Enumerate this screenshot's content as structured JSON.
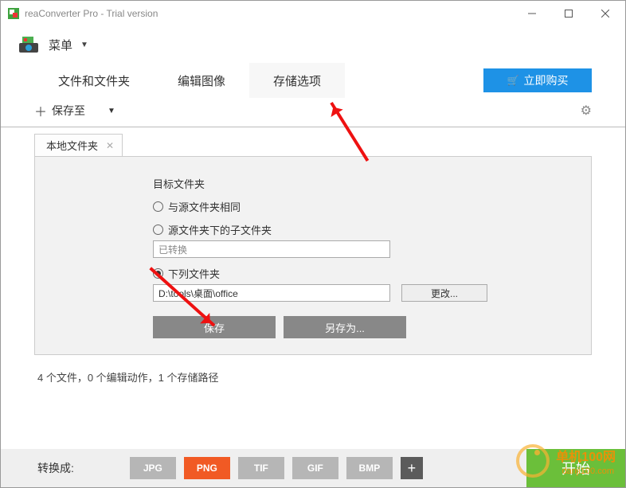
{
  "window": {
    "title": "reaConverter Pro - Trial version"
  },
  "menubar": {
    "menu_label": "菜单"
  },
  "tabs": {
    "files": "文件和文件夹",
    "edit": "编辑图像",
    "save": "存储选项"
  },
  "buy_button": "立即购买",
  "toolbar": {
    "saveto": "保存至"
  },
  "subtab": {
    "label": "本地文件夹"
  },
  "panel": {
    "section_label": "目标文件夹",
    "opt_same": "与源文件夹相同",
    "opt_subfolder": "源文件夹下的子文件夹",
    "subfolder_value": "已转换",
    "opt_following": "下列文件夹",
    "path_value": "D:\\tools\\桌面\\office",
    "change_btn": "更改...",
    "save_btn": "保存",
    "saveas_btn": "另存为..."
  },
  "status": {
    "text": "4 个文件，0 个编辑动作，1 个存储路径"
  },
  "bottombar": {
    "convert_label": "转换成:",
    "formats": {
      "jpg": "JPG",
      "png": "PNG",
      "tif": "TIF",
      "gif": "GIF",
      "bmp": "BMP"
    },
    "start": "开始"
  },
  "watermark": {
    "line1": "单机100网",
    "line2": "danji100.com"
  }
}
